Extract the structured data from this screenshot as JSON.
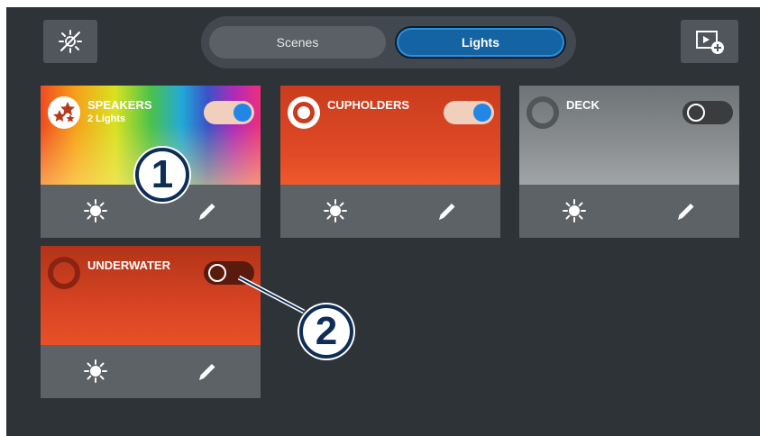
{
  "header": {
    "tabs": [
      {
        "label": "Scenes",
        "active": false
      },
      {
        "label": "Lights",
        "active": true
      }
    ],
    "left_icon": "lights-off-icon",
    "right_icon": "add-scene-icon"
  },
  "zones": [
    {
      "name": "SPEAKERS",
      "subtitle": "2 Lights",
      "on": true,
      "icon": "star-icon",
      "style": "rainbow"
    },
    {
      "name": "CUPHOLDERS",
      "on": true,
      "icon": "ring-icon",
      "style": "orange"
    },
    {
      "name": "DECK",
      "on": false,
      "icon": "ring-icon",
      "style": "gray"
    },
    {
      "name": "UNDERWATER",
      "on": false,
      "icon": "ring-icon",
      "style": "orange"
    }
  ],
  "card_actions": {
    "brightness_icon": "brightness-icon",
    "edit_icon": "pencil-icon"
  },
  "callouts": [
    "1",
    "2"
  ],
  "colors": {
    "accent": "#1463a3",
    "orange": "#e04a28",
    "background": "#2e3338"
  }
}
